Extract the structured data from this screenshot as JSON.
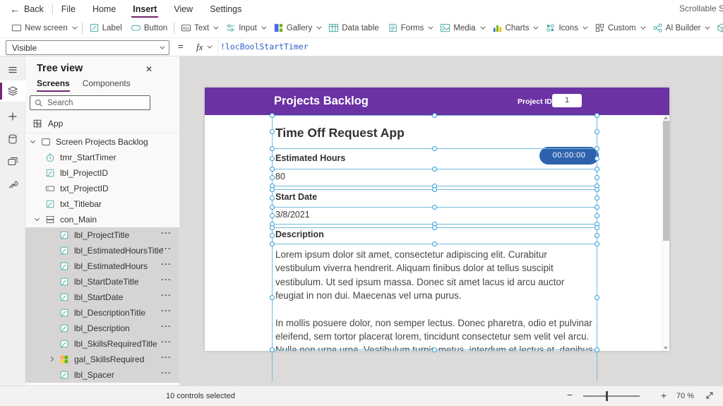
{
  "menu": {
    "back_label": "Back",
    "items": [
      {
        "label": "File"
      },
      {
        "label": "Home"
      },
      {
        "label": "Insert",
        "active": true
      },
      {
        "label": "View"
      },
      {
        "label": "Settings"
      }
    ],
    "right_text": "Scrollable Scree"
  },
  "ribbon": {
    "items": [
      {
        "label": "New screen",
        "icon": "new-screen",
        "chevron": true,
        "divider_after": true
      },
      {
        "label": "Label",
        "icon": "label"
      },
      {
        "label": "Button",
        "icon": "button",
        "divider_after": true
      },
      {
        "label": "Text",
        "icon": "text",
        "chevron": true
      },
      {
        "label": "Input",
        "icon": "input",
        "chevron": true
      },
      {
        "label": "Gallery",
        "icon": "gallery",
        "chevron": true
      },
      {
        "label": "Data table",
        "icon": "table"
      },
      {
        "label": "Forms",
        "icon": "forms",
        "chevron": true
      },
      {
        "label": "Media",
        "icon": "media",
        "chevron": true
      },
      {
        "label": "Charts",
        "icon": "charts",
        "chevron": true
      },
      {
        "label": "Icons",
        "icon": "icons",
        "chevron": true
      },
      {
        "label": "Custom",
        "icon": "custom",
        "chevron": true
      },
      {
        "label": "AI Builder",
        "icon": "ai",
        "chevron": true
      },
      {
        "label": "Mixed Reality",
        "icon": "mr",
        "chevron": true
      }
    ]
  },
  "formula_bar": {
    "property": "Visible",
    "equals": "=",
    "fx_label": "fx",
    "formula": "!locBoolStartTimer"
  },
  "tree": {
    "title": "Tree view",
    "close": "✕",
    "tabs": [
      {
        "label": "Screens",
        "active": true
      },
      {
        "label": "Components"
      }
    ],
    "search_placeholder": "Search",
    "app_label": "App",
    "screen_label": "Screen Projects Backlog",
    "more_glyph": "···",
    "rows": [
      {
        "label": "tmr_StartTimer",
        "icon": "timer",
        "level": 1
      },
      {
        "label": "lbl_ProjectID",
        "icon": "label",
        "level": 1
      },
      {
        "label": "txt_ProjectID",
        "icon": "textinput",
        "level": 1
      },
      {
        "label": "txt_Titlebar",
        "icon": "label",
        "level": 1
      },
      {
        "label": "con_Main",
        "icon": "container",
        "level": 1,
        "expanded": true
      },
      {
        "label": "lbl_ProjectTitle",
        "icon": "label",
        "level": 2,
        "selected": true
      },
      {
        "label": "lbl_EstimatedHoursTitle",
        "icon": "label",
        "level": 2,
        "selected": true
      },
      {
        "label": "lbl_EstimatedHours",
        "icon": "label",
        "level": 2,
        "selected": true
      },
      {
        "label": "lbl_StartDateTitle",
        "icon": "label",
        "level": 2,
        "selected": true
      },
      {
        "label": "lbl_StartDate",
        "icon": "label",
        "level": 2,
        "selected": true
      },
      {
        "label": "lbl_DescriptionTitle",
        "icon": "label",
        "level": 2,
        "selected": true
      },
      {
        "label": "lbl_Description",
        "icon": "label",
        "level": 2,
        "selected": true
      },
      {
        "label": "lbl_SkillsRequiredTitle",
        "icon": "label",
        "level": 2,
        "selected": true
      },
      {
        "label": "gal_SkillsRequired",
        "icon": "gallery",
        "level": 2,
        "selected": true,
        "collapsed": true
      },
      {
        "label": "lbl_Spacer",
        "icon": "label",
        "level": 2,
        "selected": true
      }
    ]
  },
  "canvas": {
    "header": {
      "title": "Projects Backlog",
      "project_id_label": "Project ID",
      "project_id_value": "1"
    },
    "timer_value": "00:00:00",
    "app_title": "Time Off Request App",
    "fields": [
      {
        "label": "Estimated Hours",
        "value": "80"
      },
      {
        "label": "Start Date",
        "value": "3/8/2021"
      }
    ],
    "description_label": "Description",
    "description_paragraphs": [
      "Lorem ipsum dolor sit amet, consectetur adipiscing elit. Curabitur vestibulum viverra hendrerit. Aliquam finibus dolor at tellus suscipit vestibulum. Ut sed ipsum massa. Donec sit amet lacus id arcu auctor feugiat in non dui. Maecenas vel urna purus.",
      "In mollis posuere dolor, non semper lectus. Donec pharetra, odio et pulvinar eleifend, sem tortor placerat lorem, tincidunt consectetur sem velit vel arcu. Nulla non urna urna. Vestibulum turpis metus, interdum et lectus at, dapibus"
    ]
  },
  "status": {
    "selection_text": "10 controls selected",
    "zoom_percent": "70 %",
    "minus": "−",
    "plus": "+"
  },
  "colors": {
    "accent_purple": "#742774",
    "screen_header_purple": "#6b32a4",
    "timer_blue": "#2f62ad",
    "selection_blue": "#2e9bd6"
  }
}
